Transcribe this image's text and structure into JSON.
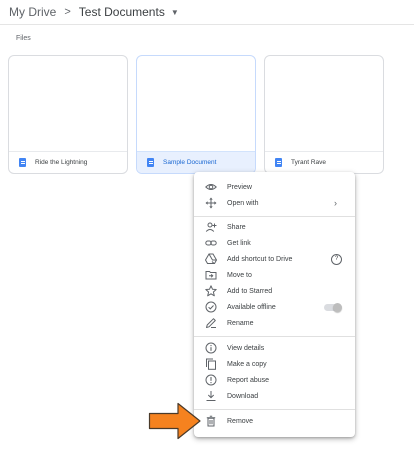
{
  "breadcrumb": {
    "root": "My Drive",
    "separator": ">",
    "current": "Test Documents"
  },
  "section_label": "Files",
  "files": [
    {
      "name": "Ride the Lightning",
      "selected": false
    },
    {
      "name": "Sample Document",
      "selected": true
    },
    {
      "name": "Tyrant Rave",
      "selected": false
    }
  ],
  "context_menu": {
    "preview": "Preview",
    "open_with": "Open with",
    "share": "Share",
    "get_link": "Get link",
    "add_shortcut": "Add shortcut to Drive",
    "move_to": "Move to",
    "add_starred": "Add to Starred",
    "available_offline": "Available offline",
    "available_offline_enabled": false,
    "rename": "Rename",
    "view_details": "View details",
    "make_copy": "Make a copy",
    "report_abuse": "Report abuse",
    "download": "Download",
    "remove": "Remove"
  },
  "colors": {
    "doc_icon": "#4285f4",
    "selected_bg": "#e8f0fe",
    "selected_text": "#1967d2",
    "arrow_fill": "#f5821f"
  },
  "icons": {
    "preview": "eye-icon",
    "open_with": "move-arrows-icon",
    "share": "person-add-icon",
    "get_link": "link-icon",
    "add_shortcut": "drive-shortcut-icon",
    "move_to": "folder-move-icon",
    "add_starred": "star-icon",
    "available_offline": "offline-check-icon",
    "rename": "pencil-icon",
    "view_details": "info-icon",
    "make_copy": "copy-icon",
    "report_abuse": "alert-icon",
    "download": "download-icon",
    "remove": "trash-icon"
  }
}
